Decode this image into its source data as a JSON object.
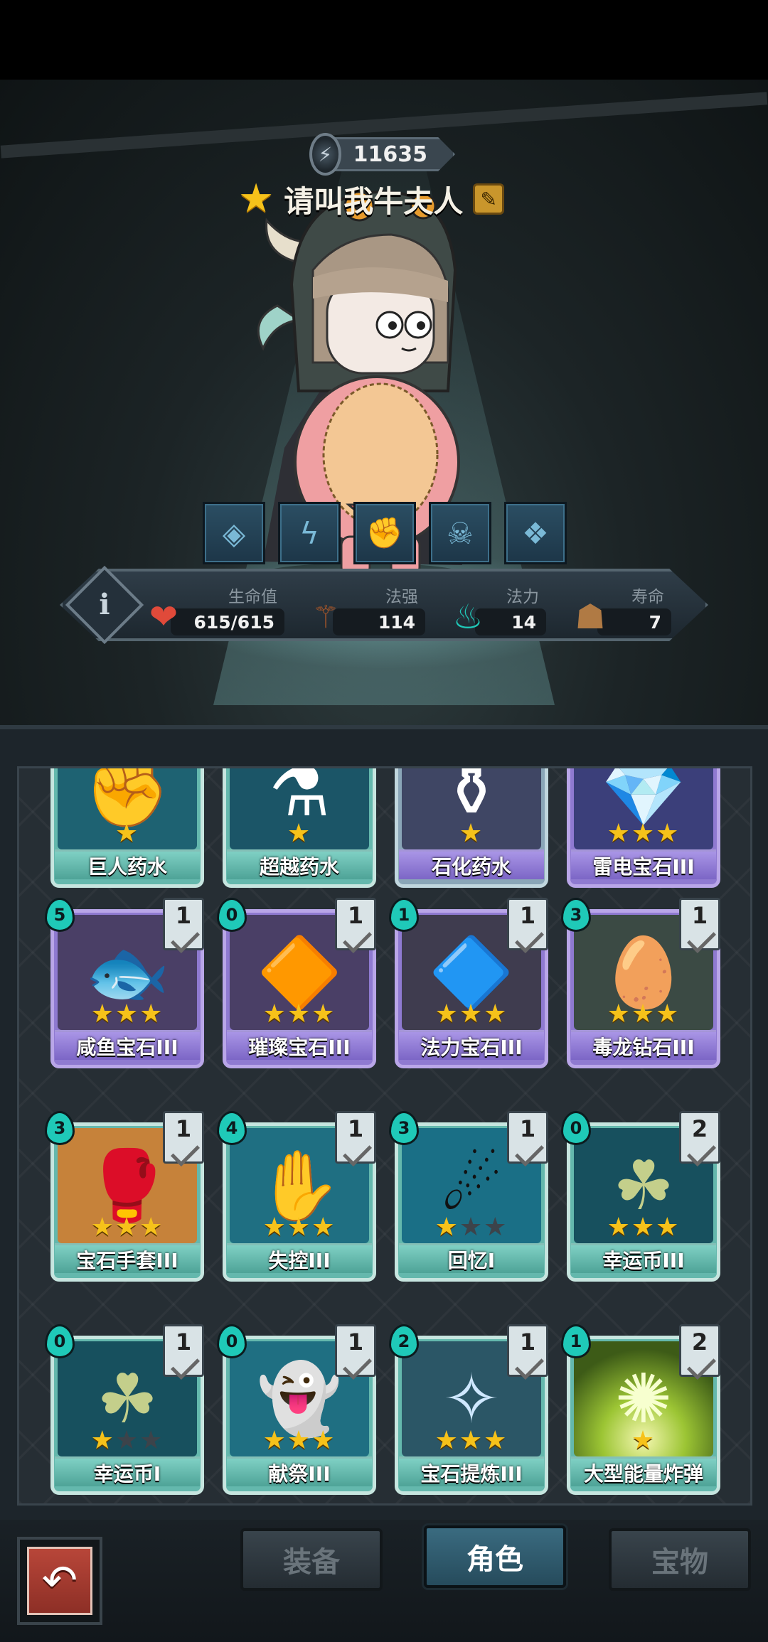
{
  "player": {
    "coins": "11635",
    "name": "请叫我牛夫人"
  },
  "icons": {
    "coin": "coin-icon",
    "star": "star-icon",
    "edit": "edit-icon",
    "info": "info-icon",
    "back": "back-arrow-icon"
  },
  "skills": [
    "diamond-skill-icon",
    "lightning-skill-icon",
    "fist-skill-icon",
    "skull-skill-icon",
    "cards-skill-icon"
  ],
  "stats": {
    "health_label": "生命值",
    "health_value": "615/615",
    "power_label": "法强",
    "power_value": "114",
    "mana_label": "法力",
    "mana_value": "14",
    "life_label": "寿命",
    "life_value": "7",
    "info_glyph": "i"
  },
  "cards": [
    {
      "name": "巨人药水",
      "stars": 1,
      "max_stars": 1,
      "tier": "teal",
      "icon": "potion-fist-icon"
    },
    {
      "name": "超越药水",
      "stars": 1,
      "max_stars": 1,
      "tier": "teal",
      "icon": "potion-blue-icon"
    },
    {
      "name": "石化药水",
      "stars": 1,
      "max_stars": 1,
      "tier": "teal",
      "icon": "potion-stone-icon"
    },
    {
      "name": "雷电宝石III",
      "stars": 3,
      "max_stars": 3,
      "tier": "purple",
      "icon": "thunder-gem-icon"
    },
    {
      "name": "咸鱼宝石III",
      "cost": "5",
      "level": "1",
      "stars": 3,
      "max_stars": 3,
      "tier": "purple",
      "icon": "fish-gem-icon"
    },
    {
      "name": "璀璨宝石III",
      "cost": "0",
      "level": "1",
      "stars": 3,
      "max_stars": 3,
      "tier": "purple",
      "icon": "brilliant-gem-icon"
    },
    {
      "name": "法力宝石III",
      "cost": "1",
      "level": "1",
      "stars": 3,
      "max_stars": 3,
      "tier": "purple",
      "icon": "mana-gem-icon"
    },
    {
      "name": "毒龙钻石III",
      "cost": "3",
      "level": "1",
      "stars": 3,
      "max_stars": 3,
      "tier": "purple",
      "icon": "dragon-diamond-icon"
    },
    {
      "name": "宝石手套III",
      "cost": "3",
      "level": "1",
      "stars": 3,
      "max_stars": 3,
      "tier": "teal",
      "icon": "gem-gauntlet-icon"
    },
    {
      "name": "失控III",
      "cost": "4",
      "level": "1",
      "stars": 3,
      "max_stars": 3,
      "tier": "teal",
      "icon": "claw-icon"
    },
    {
      "name": "回忆I",
      "cost": "3",
      "level": "1",
      "stars": 1,
      "max_stars": 3,
      "tier": "teal",
      "icon": "memory-icon"
    },
    {
      "name": "幸运币III",
      "cost": "0",
      "level": "2",
      "stars": 3,
      "max_stars": 3,
      "tier": "teal",
      "icon": "lucky-coin-icon"
    },
    {
      "name": "幸运币I",
      "cost": "0",
      "level": "1",
      "stars": 1,
      "max_stars": 3,
      "tier": "teal",
      "icon": "lucky-coin-icon"
    },
    {
      "name": "献祭III",
      "cost": "0",
      "level": "1",
      "stars": 3,
      "max_stars": 3,
      "tier": "teal",
      "icon": "sacrifice-icon"
    },
    {
      "name": "宝石提炼III",
      "cost": "2",
      "level": "1",
      "stars": 3,
      "max_stars": 3,
      "tier": "teal",
      "icon": "gem-refine-icon"
    },
    {
      "name": "大型能量炸弹",
      "cost": "1",
      "level": "2",
      "stars": 1,
      "max_stars": 1,
      "tier": "teal",
      "icon": "energy-bomb-icon"
    }
  ],
  "nav": {
    "equipment": "装备",
    "character": "角色",
    "treasure": "宝物",
    "active": "character"
  },
  "colors": {
    "star": "#f6c21a",
    "mana": "#1fc9b8",
    "active_tab": "#3a6b80",
    "back_button": "#b84639"
  }
}
